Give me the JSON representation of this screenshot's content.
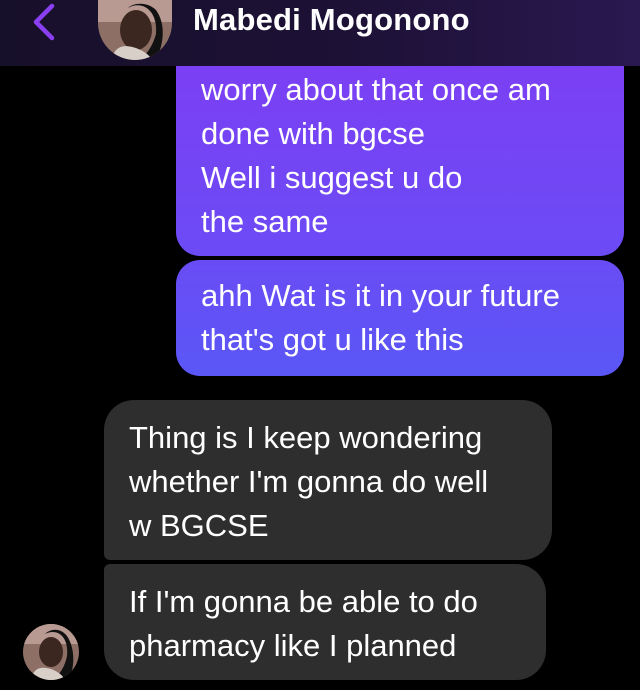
{
  "header": {
    "contact_name": "Mabedi Mogonono",
    "back_icon": "chevron-left-icon",
    "accent_color": "#8b3ff2"
  },
  "messages": [
    {
      "direction": "sent",
      "lines": [
        "worry about that once am",
        "done with bgcse",
        "Well i suggest u do",
        "the same"
      ]
    },
    {
      "direction": "sent",
      "lines": [
        "ahh Wat is it in your future",
        "that's got u like this"
      ]
    },
    {
      "direction": "received",
      "lines": [
        "Thing is I keep wondering",
        "whether I'm gonna do well",
        "w BGCSE"
      ]
    },
    {
      "direction": "received",
      "lines": [
        "If I'm gonna be able to do",
        "pharmacy like I planned"
      ]
    }
  ],
  "colors": {
    "background": "#000000",
    "sent_bubble_top": "#7e3ef3",
    "sent_bubble_bottom": "#5a57f6",
    "received_bubble": "#2e2e2e"
  }
}
